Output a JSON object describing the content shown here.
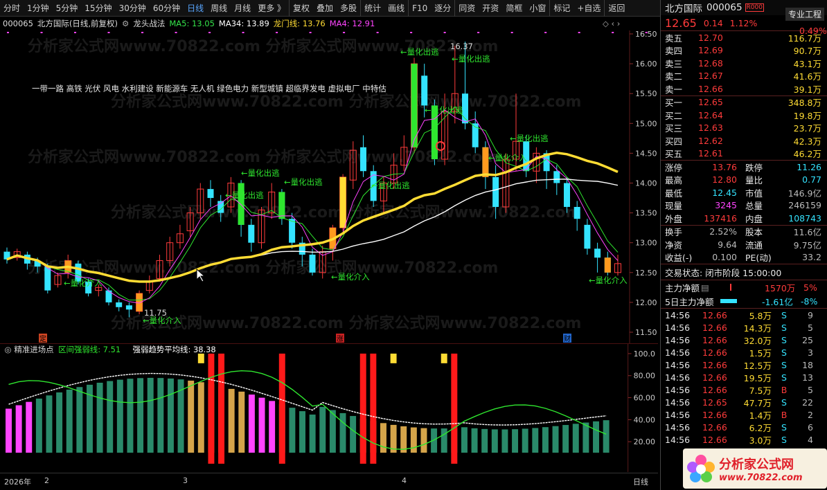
{
  "toolbar": {
    "items": [
      "分时",
      "1分钟",
      "5分钟",
      "15分钟",
      "30分钟",
      "60分钟",
      "日线",
      "周线",
      "月线",
      "更多 》",
      "复权",
      "叠加",
      "多股",
      "统计",
      "画线",
      "F10",
      "逐分",
      "同资",
      "开资",
      "简框",
      "小窗",
      "标记",
      "+自选",
      "返回"
    ],
    "active": "日线"
  },
  "status": {
    "code": "000065",
    "name": "北方国际",
    "period": "(日线,前复权)",
    "indicator": "龙头战法",
    "ma5": "MA5: 13.05",
    "ma34": "MA34: 13.89",
    "longmen": "龙门线: 13.76",
    "ma4": "MA4: 12.91",
    "colors": {
      "ma5": "#34e34a",
      "ma34": "#ffffff",
      "longmen": "#ffdc34",
      "ma4": "#ff44ff"
    }
  },
  "main_chart": {
    "concepts": "一带一路 高铁 光伏 风电 水利建设 新能源车 无人机 绿色电力 新型城镇 超临界发电 虚拟电厂 中特估",
    "high_label": "16.37",
    "low_label": "11.75",
    "price_axis": [
      "16.50",
      "16.00",
      "15.50",
      "15.00",
      "14.50",
      "14.00",
      "13.50",
      "13.00",
      "12.50",
      "12.00",
      "11.50"
    ],
    "annotations": {
      "escape": "←量化出逃",
      "entry": "←量化介入"
    },
    "markers": {
      "ding": "定",
      "zhang": "涨",
      "cai": "财"
    }
  },
  "chart_data": [
    {
      "type": "line",
      "title": "龙头战法",
      "x_range": [
        1,
        60
      ],
      "ylim": [
        11.5,
        16.5
      ],
      "series": [
        {
          "name": "MA5",
          "last": 13.05
        },
        {
          "name": "MA34",
          "last": 13.89
        },
        {
          "name": "龙门线",
          "last": 13.76
        },
        {
          "name": "MA4",
          "last": 12.91
        }
      ],
      "annotations": [
        "16.37",
        "11.75"
      ]
    },
    {
      "type": "bar",
      "title": "精准进场点",
      "ylim": [
        0,
        100
      ],
      "yticks": [
        20,
        40,
        60,
        80,
        100
      ],
      "series": [
        {
          "name": "区间强弱线",
          "last": 7.51
        },
        {
          "name": "强弱趋势平均线",
          "last": 38.38
        }
      ]
    }
  ],
  "sub_chart": {
    "title": "精准进场点",
    "line1": "区间强弱线: 7.51",
    "line2": "强弱趋势平均线: 38.38",
    "axis": [
      "100.0",
      "80.00",
      "60.00",
      "40.00",
      "20.00"
    ]
  },
  "date_axis": {
    "year": "2026年",
    "m2": "2",
    "m3": "3",
    "m4": "4",
    "period": "日线"
  },
  "quote": {
    "name": "北方国际",
    "code": "000065",
    "badge": "R000",
    "tab": "专业工程",
    "price": "12.65",
    "change": "0.14",
    "pct": "1.12%",
    "pct2": "0.49%"
  },
  "asks": [
    {
      "l": "卖五",
      "p": "12.70",
      "v": "116.7万"
    },
    {
      "l": "卖四",
      "p": "12.69",
      "v": "90.7万"
    },
    {
      "l": "卖三",
      "p": "12.68",
      "v": "43.1万"
    },
    {
      "l": "卖二",
      "p": "12.67",
      "v": "41.6万"
    },
    {
      "l": "卖一",
      "p": "12.66",
      "v": "39.1万"
    }
  ],
  "bids": [
    {
      "l": "买一",
      "p": "12.65",
      "v": "348.8万"
    },
    {
      "l": "买二",
      "p": "12.64",
      "v": "19.8万"
    },
    {
      "l": "买三",
      "p": "12.63",
      "v": "23.7万"
    },
    {
      "l": "买四",
      "p": "12.62",
      "v": "42.3万"
    },
    {
      "l": "买五",
      "p": "12.61",
      "v": "46.2万"
    }
  ],
  "stats": [
    {
      "k1": "涨停",
      "v1": "13.76",
      "c1": "red",
      "k2": "跌停",
      "v2": "11.26",
      "c2": "cyan"
    },
    {
      "k1": "最高",
      "v1": "12.80",
      "c1": "red",
      "k2": "量比",
      "v2": "0.77",
      "c2": "cyan"
    },
    {
      "k1": "最低",
      "v1": "12.45",
      "c1": "cyan",
      "k2": "市值",
      "v2": "146.9亿",
      "c2": "gray"
    },
    {
      "k1": "现量",
      "v1": "3245",
      "c1": "magenta",
      "k2": "总量",
      "v2": "246159",
      "c2": "gray"
    },
    {
      "k1": "外盘",
      "v1": "137416",
      "c1": "red",
      "k2": "内盘",
      "v2": "108743",
      "c2": "cyan"
    }
  ],
  "fund": [
    {
      "k1": "换手",
      "v1": "2.52%",
      "k2": "股本",
      "v2": "11.6亿"
    },
    {
      "k1": "净资",
      "v1": "9.64",
      "k2": "流通",
      "v2": "9.75亿"
    },
    {
      "k1": "收益(-)",
      "v1": "0.100",
      "k2": "PE(动)",
      "v2": "33.2"
    }
  ],
  "trade_state": "交易状态: 闭市阶段 15:00:00",
  "capital": {
    "label1": "主力净额",
    "v1": "1570万",
    "p1": "5%",
    "label2": "5日主力净额",
    "v2": "-1.61亿",
    "p2": "-8%"
  },
  "ticks": [
    {
      "t": "14:56",
      "p": "12.66",
      "v": "5.8万",
      "s": "S",
      "n": "9"
    },
    {
      "t": "14:56",
      "p": "12.66",
      "v": "14.3万",
      "s": "S",
      "n": "5"
    },
    {
      "t": "14:56",
      "p": "12.66",
      "v": "32.0万",
      "s": "S",
      "n": "25"
    },
    {
      "t": "14:56",
      "p": "12.66",
      "v": "1.5万",
      "s": "S",
      "n": "3"
    },
    {
      "t": "14:56",
      "p": "12.66",
      "v": "12.5万",
      "s": "S",
      "n": "18"
    },
    {
      "t": "14:56",
      "p": "12.66",
      "v": "19.5万",
      "s": "S",
      "n": "13"
    },
    {
      "t": "14:56",
      "p": "12.66",
      "v": "7.5万",
      "s": "B",
      "n": "5"
    },
    {
      "t": "14:56",
      "p": "12.65",
      "v": "47.7万",
      "s": "S",
      "n": "22"
    },
    {
      "t": "14:56",
      "p": "12.66",
      "v": "1.4万",
      "s": "B",
      "n": "2"
    },
    {
      "t": "14:56",
      "p": "12.66",
      "v": "6.2万",
      "s": "S",
      "n": "6"
    },
    {
      "t": "14:56",
      "p": "12.66",
      "v": "3.0万",
      "s": "S",
      "n": "4"
    }
  ],
  "logo": {
    "title": "分析家公式网",
    "url": "www.70822.com"
  }
}
